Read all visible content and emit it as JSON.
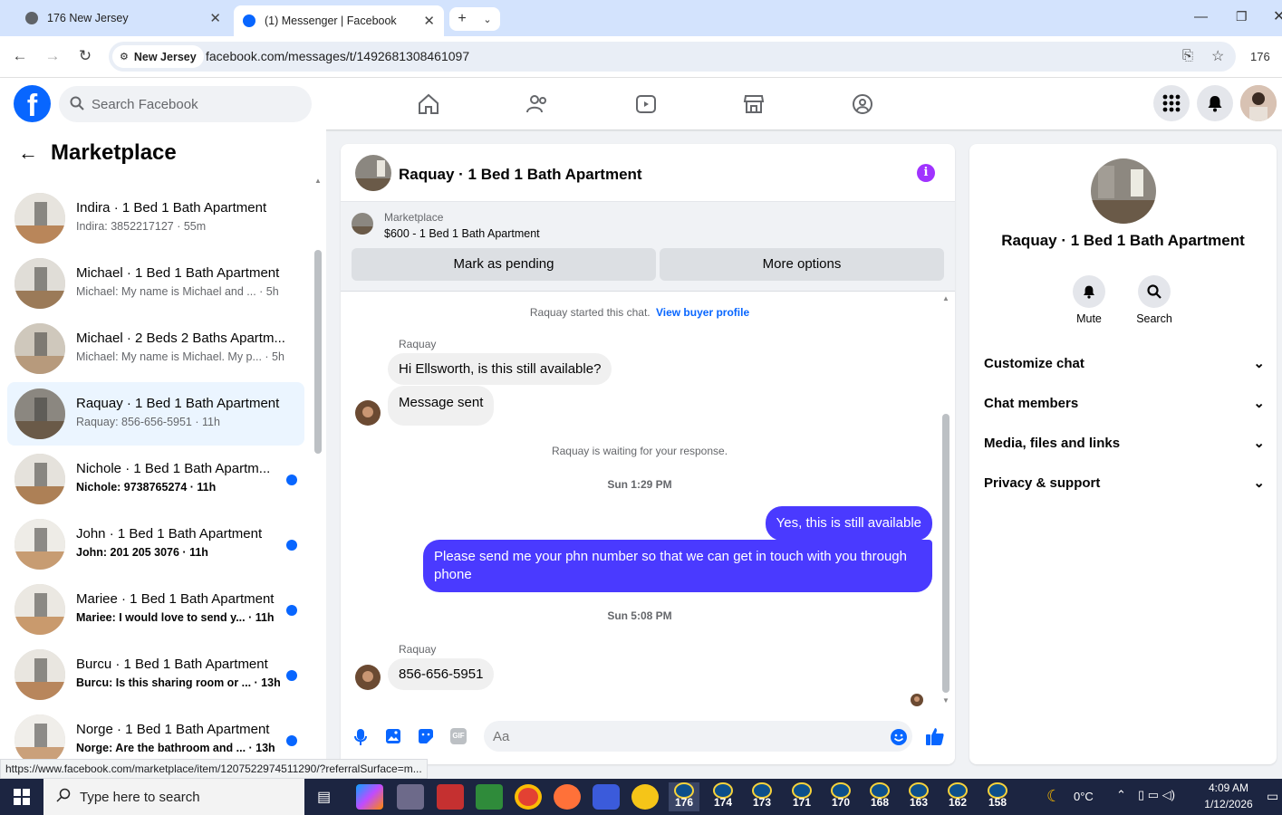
{
  "browser": {
    "tabs": [
      {
        "title": "176 New Jersey",
        "active": false
      },
      {
        "title": "(1) Messenger | Facebook",
        "active": true
      }
    ],
    "site_chip": "New Jersey",
    "url": "facebook.com/messages/t/1492681308461097",
    "profile_label": "176"
  },
  "facebook": {
    "search_placeholder": "Search Facebook",
    "brand_color": "#0866ff"
  },
  "left_panel": {
    "title": "Marketplace",
    "conversations": [
      {
        "name": "Indira · 1 Bed 1 Bath Apartment",
        "preview": "Indira: 3852217127 · 55m",
        "unread": false,
        "selected": false
      },
      {
        "name": "Michael · 1 Bed 1 Bath Apartment",
        "preview": "Michael: My name is Michael and ... · 5h",
        "unread": false,
        "selected": false
      },
      {
        "name": "Michael · 2 Beds 2 Baths Apartm...",
        "preview": "Michael: My name is Michael. My p... · 5h",
        "unread": false,
        "selected": false
      },
      {
        "name": "Raquay · 1 Bed 1 Bath Apartment",
        "preview": "Raquay: 856-656-5951 · 11h",
        "unread": false,
        "selected": true
      },
      {
        "name": "Nichole · 1 Bed 1 Bath Apartm...",
        "preview": "Nichole: 9738765274 · 11h",
        "unread": true,
        "selected": false
      },
      {
        "name": "John · 1 Bed 1 Bath Apartment",
        "preview": "John: 201 205 3076 · 11h",
        "unread": true,
        "selected": false
      },
      {
        "name": "Mariee · 1 Bed 1 Bath Apartment",
        "preview": "Mariee: I would love to send y... · 11h",
        "unread": true,
        "selected": false
      },
      {
        "name": "Burcu · 1 Bed 1 Bath Apartment",
        "preview": "Burcu: Is this sharing room or ... · 13h",
        "unread": true,
        "selected": false
      },
      {
        "name": "Norge · 1 Bed 1 Bath Apartment",
        "preview": "Norge: Are the bathroom and ... · 13h",
        "unread": true,
        "selected": false
      }
    ]
  },
  "chat": {
    "title": "Raquay · 1 Bed 1 Bath Apartment",
    "marketplace_label": "Marketplace",
    "listing": "$600 - 1 Bed 1 Bath Apartment",
    "mark_pending": "Mark as pending",
    "more_options": "More options",
    "started_text": "Raquay started this chat.",
    "buyer_profile_link": "View buyer profile",
    "sender_name": "Raquay",
    "msg1": "Hi Ellsworth, is this still available?",
    "msg2": "Message sent",
    "waiting": "Raquay is waiting for your response.",
    "time1": "Sun 1:29 PM",
    "out1": "Yes, this is still available",
    "out2": "Please send me your phn number so that we can get in touch with you through phone",
    "time2": "Sun 5:08 PM",
    "msg3": "856-656-5951",
    "input_placeholder": "Aa",
    "outgoing_color": "#4a3aff"
  },
  "right_panel": {
    "name": "Raquay · 1 Bed 1 Bath Apartment",
    "mute_label": "Mute",
    "search_label": "Search",
    "sections": [
      "Customize chat",
      "Chat members",
      "Media, files and links",
      "Privacy & support"
    ]
  },
  "status_url": "https://www.facebook.com/marketplace/item/1207522974511290/?referralSurface=m...",
  "taskbar": {
    "search_placeholder": "Type here to search",
    "windows": [
      "176",
      "174",
      "173",
      "171",
      "170",
      "168",
      "163",
      "162",
      "158"
    ],
    "weather": "0°C",
    "time": "4:09 AM",
    "date": "1/12/2026"
  }
}
